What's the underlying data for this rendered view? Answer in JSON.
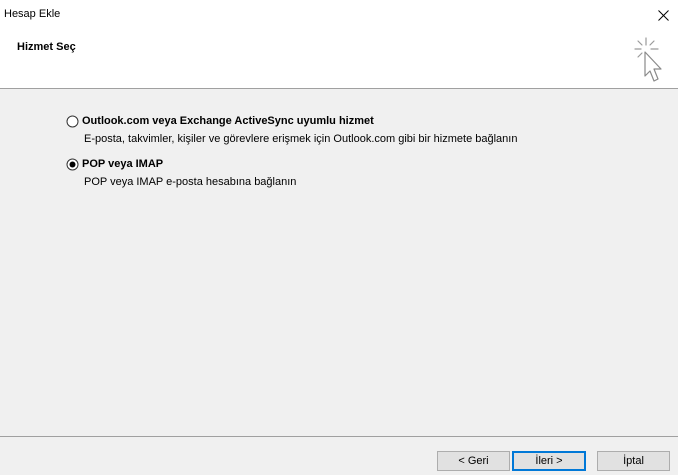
{
  "window": {
    "title": "Hesap Ekle"
  },
  "header": {
    "title": "Hizmet Seç",
    "icon": "wizard-cursor-icon"
  },
  "options": [
    {
      "label": "Outlook.com veya Exchange ActiveSync uyumlu hizmet",
      "description": "E-posta, takvimler, kişiler ve görevlere erişmek için Outlook.com gibi bir hizmete bağlanın",
      "selected": false
    },
    {
      "label": "POP veya IMAP",
      "description": "POP veya IMAP e-posta hesabına bağlanın",
      "selected": true
    }
  ],
  "footer": {
    "back_label": "< Geri",
    "next_label": "İleri >",
    "cancel_label": "İptal"
  },
  "colors": {
    "body_bg": "#f0f0f0",
    "focus_border": "#0078d7"
  }
}
